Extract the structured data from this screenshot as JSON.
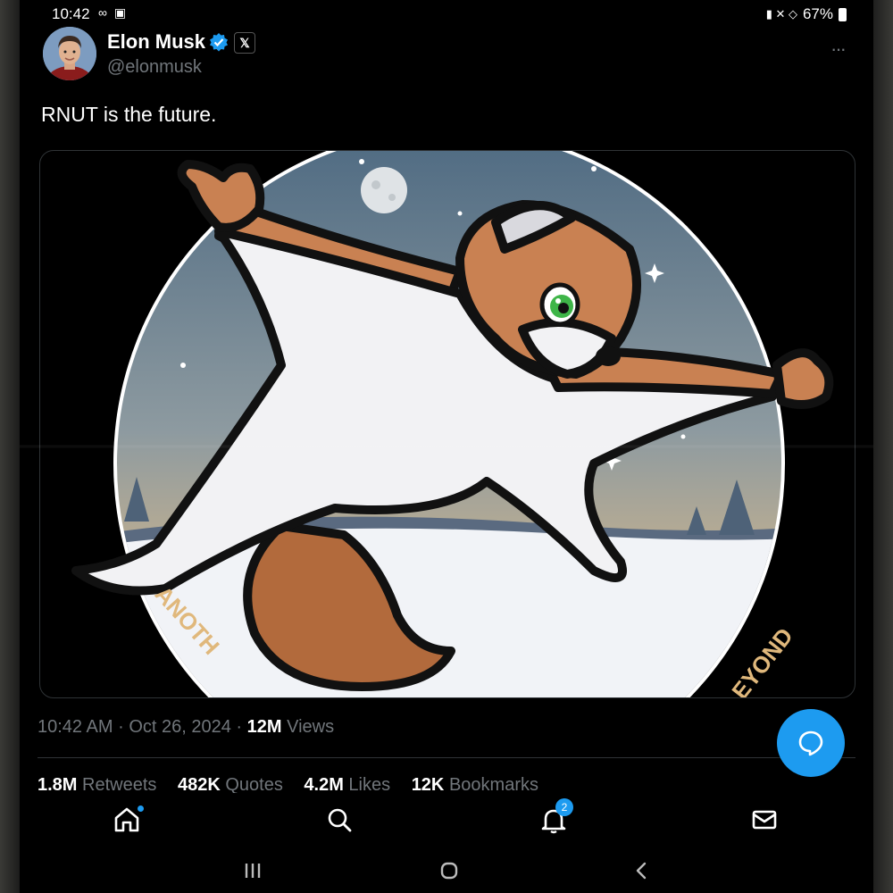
{
  "status_bar": {
    "time": "10:42",
    "left_icons": "∞ ▣",
    "right_icons": "▮ ✕ ◇",
    "battery_percent": "67%"
  },
  "tweet": {
    "display_name": "Elon Musk",
    "handle": "@elonmusk",
    "affiliate_badge": "𝕏",
    "more_label": "···",
    "text": "RNUT is the future.",
    "image": {
      "arc_text_left": "ANOTH",
      "arc_text_right": "EYOND"
    },
    "time": "10:42 AM",
    "sep1": "·",
    "date": "Oct 26, 2024",
    "sep2": "·",
    "views_count": "12M",
    "views_label": "Views"
  },
  "stats": {
    "retweets_count": "1.8M",
    "retweets_label": "Retweets",
    "quotes_count": "482K",
    "quotes_label": "Quotes",
    "likes_count": "4.2M",
    "likes_label": "Likes",
    "bookmarks_count": "12K",
    "bookmarks_label": "Bookmarks"
  },
  "nav": {
    "notifications_badge": "2"
  },
  "icons": {
    "home": "home-icon",
    "search": "search-icon",
    "notifications": "bell-icon",
    "messages": "mail-icon",
    "reply": "reply-icon"
  },
  "colors": {
    "accent": "#1d9bf0",
    "background": "#000000",
    "muted": "#71767b"
  }
}
